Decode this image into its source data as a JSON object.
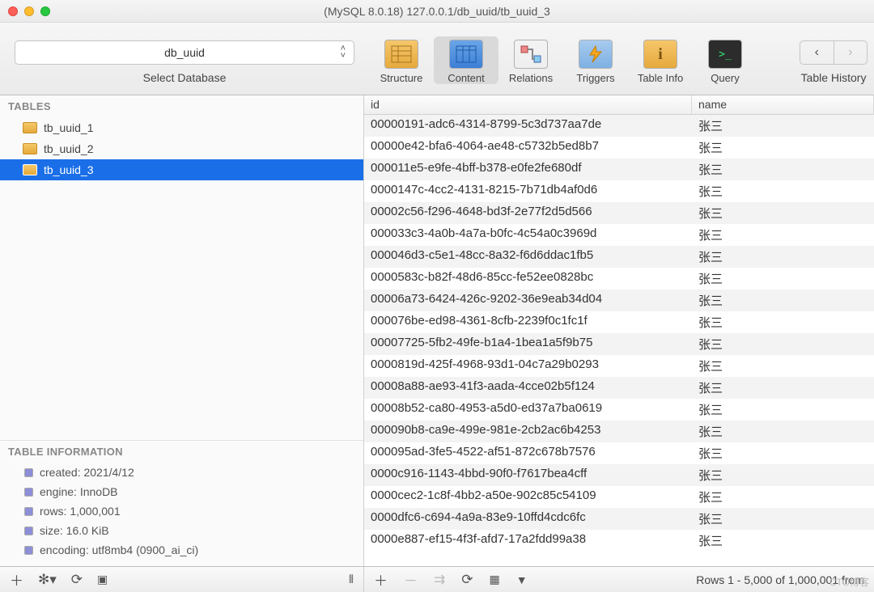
{
  "window_title": "(MySQL 8.0.18) 127.0.0.1/db_uuid/tb_uuid_3",
  "db_selector": {
    "value": "db_uuid",
    "label": "Select Database"
  },
  "toolbar": {
    "structure": "Structure",
    "content": "Content",
    "relations": "Relations",
    "triggers": "Triggers",
    "table_info": "Table Info",
    "query": "Query",
    "history": "Table History"
  },
  "sidebar": {
    "tables_header": "TABLES",
    "tables": [
      "tb_uuid_1",
      "tb_uuid_2",
      "tb_uuid_3"
    ],
    "selected": "tb_uuid_3",
    "info_header": "TABLE INFORMATION",
    "info": {
      "created": "created: 2021/4/12",
      "engine": "engine: InnoDB",
      "rows": "rows: 1,000,001",
      "size": "size: 16.0 KiB",
      "encoding": "encoding: utf8mb4 (0900_ai_ci)"
    }
  },
  "columns": {
    "id": "id",
    "name": "name"
  },
  "rows": [
    {
      "id": "00000191-adc6-4314-8799-5c3d737aa7de",
      "name": "张三"
    },
    {
      "id": "00000e42-bfa6-4064-ae48-c5732b5ed8b7",
      "name": "张三"
    },
    {
      "id": "000011e5-e9fe-4bff-b378-e0fe2fe680df",
      "name": "张三"
    },
    {
      "id": "0000147c-4cc2-4131-8215-7b71db4af0d6",
      "name": "张三"
    },
    {
      "id": "00002c56-f296-4648-bd3f-2e77f2d5d566",
      "name": "张三"
    },
    {
      "id": "000033c3-4a0b-4a7a-b0fc-4c54a0c3969d",
      "name": "张三"
    },
    {
      "id": "000046d3-c5e1-48cc-8a32-f6d6ddac1fb5",
      "name": "张三"
    },
    {
      "id": "0000583c-b82f-48d6-85cc-fe52ee0828bc",
      "name": "张三"
    },
    {
      "id": "00006a73-6424-426c-9202-36e9eab34d04",
      "name": "张三"
    },
    {
      "id": "000076be-ed98-4361-8cfb-2239f0c1fc1f",
      "name": "张三"
    },
    {
      "id": "00007725-5fb2-49fe-b1a4-1bea1a5f9b75",
      "name": "张三"
    },
    {
      "id": "0000819d-425f-4968-93d1-04c7a29b0293",
      "name": "张三"
    },
    {
      "id": "00008a88-ae93-41f3-aada-4cce02b5f124",
      "name": "张三"
    },
    {
      "id": "00008b52-ca80-4953-a5d0-ed37a7ba0619",
      "name": "张三"
    },
    {
      "id": "000090b8-ca9e-499e-981e-2cb2ac6b4253",
      "name": "张三"
    },
    {
      "id": "000095ad-3fe5-4522-af51-872c678b7576",
      "name": "张三"
    },
    {
      "id": "0000c916-1143-4bbd-90f0-f7617bea4cff",
      "name": "张三"
    },
    {
      "id": "0000cec2-1c8f-4bb2-a50e-902c85c54109",
      "name": "张三"
    },
    {
      "id": "0000dfc6-c694-4a9a-83e9-10ffd4cdc6fc",
      "name": "张三"
    },
    {
      "id": "0000e887-ef15-4f3f-afd7-17a2fdd99a38",
      "name": "张三"
    }
  ],
  "status": "Rows 1 - 5,000 of 1,000,001 from"
}
